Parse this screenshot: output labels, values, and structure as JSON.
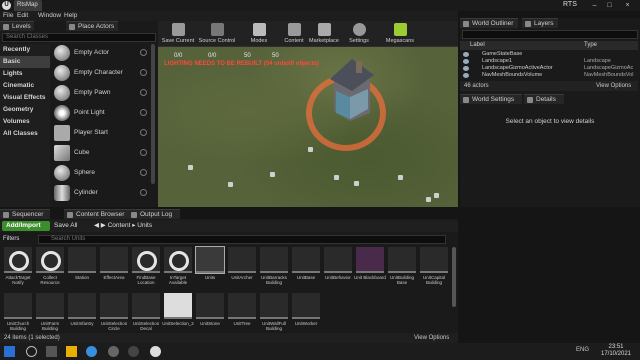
{
  "window": {
    "tab_title": "RtsMap",
    "project": "RTS",
    "minimize": "–",
    "maximize": "□",
    "close": "×"
  },
  "menu": [
    "File",
    "Edit",
    "Window",
    "Help"
  ],
  "modes": {
    "tabs": [
      "Levels",
      "Place Actors"
    ],
    "search_placeholder": "Search Classes",
    "categories": [
      "Recently Placed",
      "Basic",
      "Lights",
      "Cinematic",
      "Visual Effects",
      "Geometry",
      "Volumes",
      "All Classes"
    ],
    "active_category": "Basic",
    "items": [
      "Empty Actor",
      "Empty Character",
      "Empty Pawn",
      "Point Light",
      "Player Start",
      "Cube",
      "Sphere",
      "Cylinder"
    ]
  },
  "toolbar": [
    "Save Current",
    "Source Control",
    "Modes",
    "Content",
    "Marketplace",
    "Settings",
    "Megascans"
  ],
  "viewport": {
    "stats": [
      "0/0",
      "0/0",
      "50",
      "50"
    ],
    "warning": "LIGHTING NEEDS TO BE REBUILT (54 unbuilt objects)"
  },
  "outliner": {
    "tabs": [
      "World Outliner",
      "Layers"
    ],
    "columns": [
      "Label",
      "Type"
    ],
    "rows": [
      {
        "label": "GameStateBase",
        "type": ""
      },
      {
        "label": "Landscape1",
        "type": "Landscape"
      },
      {
        "label": "LandscapeGizmoActiveActor",
        "type": "LandscapeGizmoAc"
      },
      {
        "label": "NavMeshBoundsVolume",
        "type": "NavMeshBoundsVol"
      }
    ],
    "count": "46 actors",
    "view_options": "View Options"
  },
  "details": {
    "tabs": [
      "World Settings",
      "Details"
    ],
    "message": "Select an object to view details"
  },
  "content_browser": {
    "tabs": [
      "Sequencer",
      "Content Browser",
      "Output Log"
    ],
    "add_import": "Add/Import",
    "save_all": "Save All",
    "breadcrumb": [
      "Content",
      "Units"
    ],
    "filters": "Filters",
    "search_placeholder": "Search Units",
    "assets_row1": [
      {
        "label": "AttackTarget Notify",
        "style": "ring"
      },
      {
        "label": "Collect Resource",
        "style": "ring"
      },
      {
        "label": "Station",
        "style": "plain"
      },
      {
        "label": "EffectArea",
        "style": "plain"
      },
      {
        "label": "FindBase Location",
        "style": "ring"
      },
      {
        "label": "InTarget Available",
        "style": "ring"
      },
      {
        "label": "Units",
        "style": "sel"
      },
      {
        "label": "UnitArcher",
        "style": "plain"
      },
      {
        "label": "UnitBarracks Building",
        "style": "plain"
      },
      {
        "label": "UnitBase",
        "style": "plain"
      },
      {
        "label": "UnitBehavior",
        "style": "plain"
      },
      {
        "label": "Unit Blackboard",
        "style": "plain"
      },
      {
        "label": "UnitBuilding Base",
        "style": "plain"
      },
      {
        "label": "UnitCapital Building",
        "style": "plain"
      }
    ],
    "assets_row2": [
      "UnitChurch Building",
      "UnitFarm Building",
      "UnitInfantry",
      "UnitSelection Circle",
      "UnitSelection Decal",
      "UnitSelection_2",
      "UnitStone",
      "UnitTree",
      "UnitWallFull Building",
      "UnitWorker"
    ],
    "status": "24 items (1 selected)",
    "view_options": "View Options"
  },
  "taskbar": {
    "time": "23:51",
    "date": "17/10/2021",
    "lang": "ENG"
  }
}
